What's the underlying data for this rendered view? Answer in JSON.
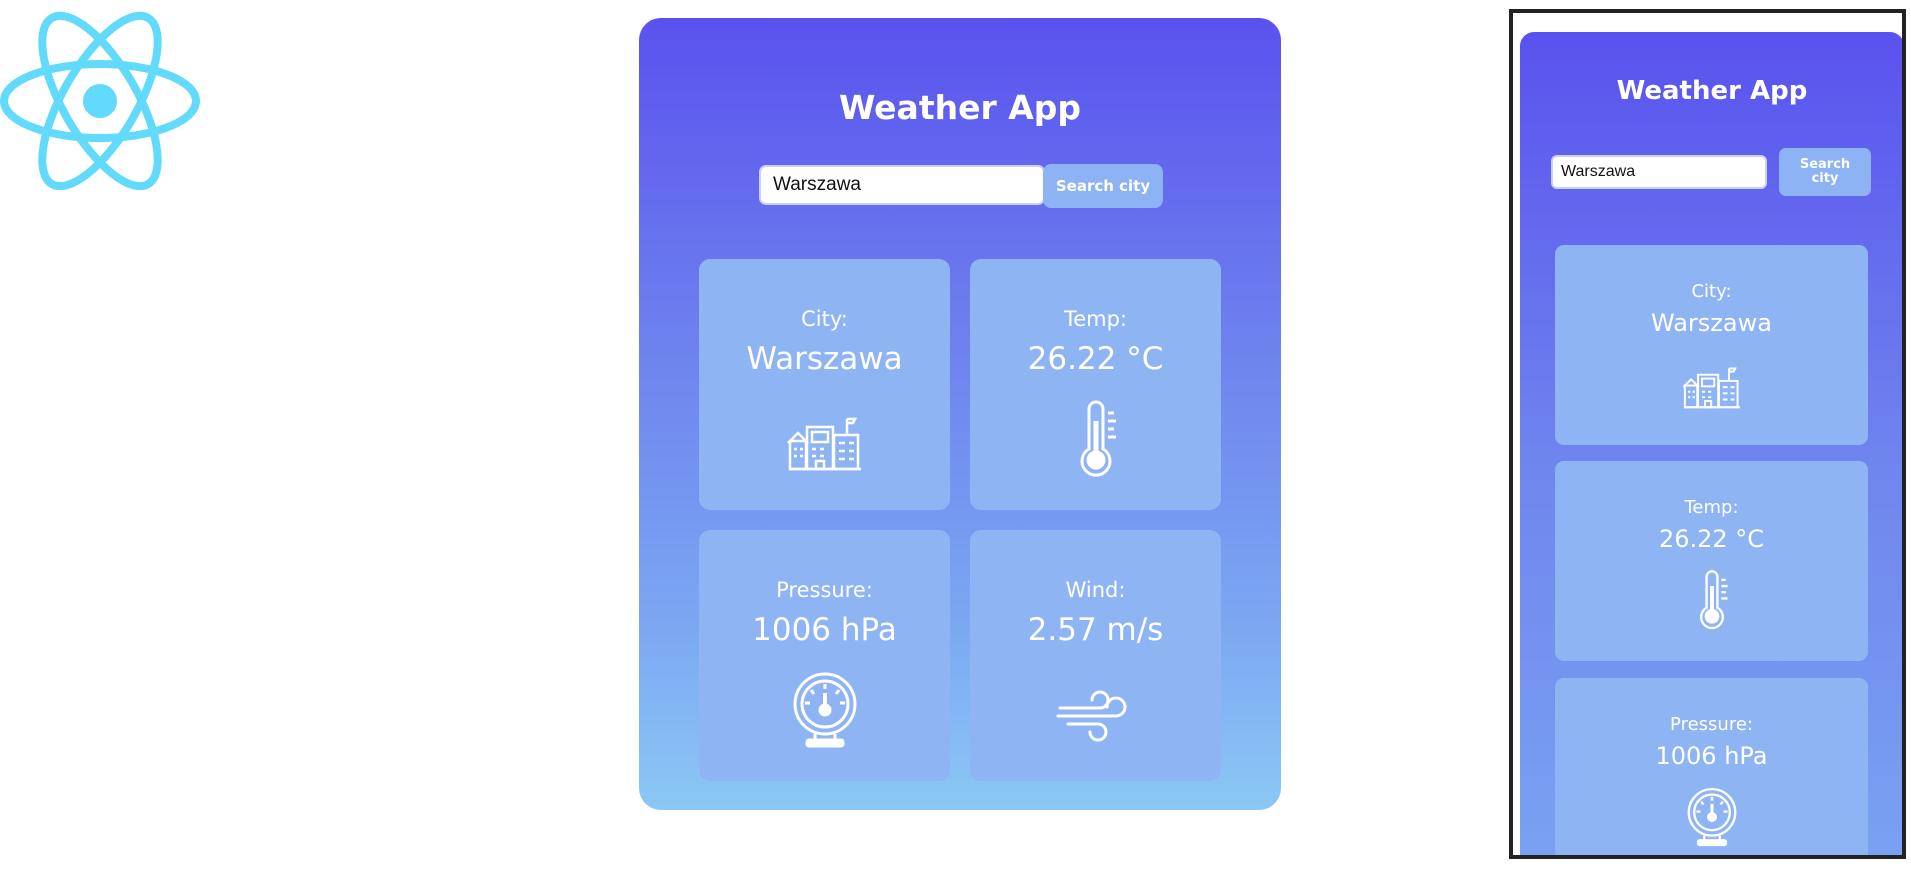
{
  "title": "Weather App",
  "search": {
    "value": "Warszawa",
    "button_label": "Search city"
  },
  "cards": {
    "city": {
      "label": "City:",
      "value": "Warszawa",
      "icon": "city-buildings-icon"
    },
    "temp": {
      "label": "Temp:",
      "value": "26.22 °C",
      "icon": "thermometer-icon"
    },
    "pressure": {
      "label": "Pressure:",
      "value": "1006 hPa",
      "icon": "barometer-gauge-icon"
    },
    "wind": {
      "label": "Wind:",
      "value": "2.57 m/s",
      "icon": "wind-icon"
    }
  },
  "colors": {
    "gradient_top": "#5a52ef",
    "gradient_bottom": "#8bc8f5",
    "tile": "#8fb4f4",
    "text": "#ffffff",
    "logo": "#61dafb"
  },
  "logo_icon": "react-logo-icon"
}
